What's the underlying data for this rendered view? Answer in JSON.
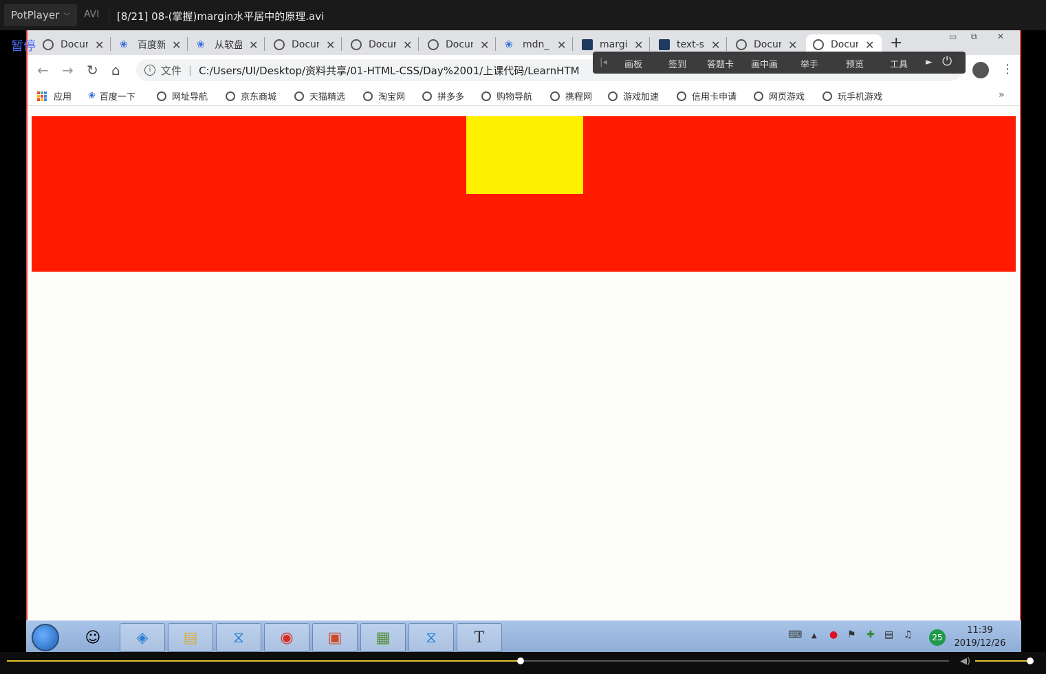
{
  "player": {
    "name": "PotPlayer",
    "format": "AVI",
    "file_title": "[8/21] 08-(掌握)margin水平居中的原理.avi",
    "state_label": "暂停",
    "seek_progress": 0.545,
    "volume": 0.98
  },
  "tabs": [
    {
      "label": "Docur",
      "icon": "globe-icon"
    },
    {
      "label": "百度新",
      "icon": "baidu-paw-icon"
    },
    {
      "label": "从软盘",
      "icon": "baidu-paw-icon"
    },
    {
      "label": "Docur",
      "icon": "globe-icon"
    },
    {
      "label": "Docur",
      "icon": "globe-icon"
    },
    {
      "label": "Docur",
      "icon": "globe-icon"
    },
    {
      "label": "mdn_",
      "icon": "baidu-paw-icon"
    },
    {
      "label": "margi",
      "icon": "mdn-icon"
    },
    {
      "label": "text-s",
      "icon": "mdn-icon"
    },
    {
      "label": "Docur",
      "icon": "globe-icon"
    },
    {
      "label": "Docur",
      "icon": "globe-icon",
      "active": true
    }
  ],
  "omnibox": {
    "protocol_label": "文件",
    "url": "C:/Users/UI/Desktop/资料共享/01-HTML-CSS/Day%2001/上课代码/LearnHTM"
  },
  "overlay_toolbar": [
    "画板",
    "签到",
    "答题卡",
    "画中画",
    "举手",
    "预览",
    "工具"
  ],
  "bookmarks": [
    "应用",
    "百度一下",
    "网址导航",
    "京东商城",
    "天猫精选",
    "淘宝网",
    "拼多多",
    "购物导航",
    "携程网",
    "游戏加速",
    "信用卡申请",
    "网页游戏",
    "玩手机游戏"
  ],
  "page": {
    "outer_color": "#ff1a00",
    "inner_color": "#fff000"
  },
  "taskbar": {
    "tray_badge": "25",
    "time": "11:39",
    "date": "2019/12/26"
  }
}
